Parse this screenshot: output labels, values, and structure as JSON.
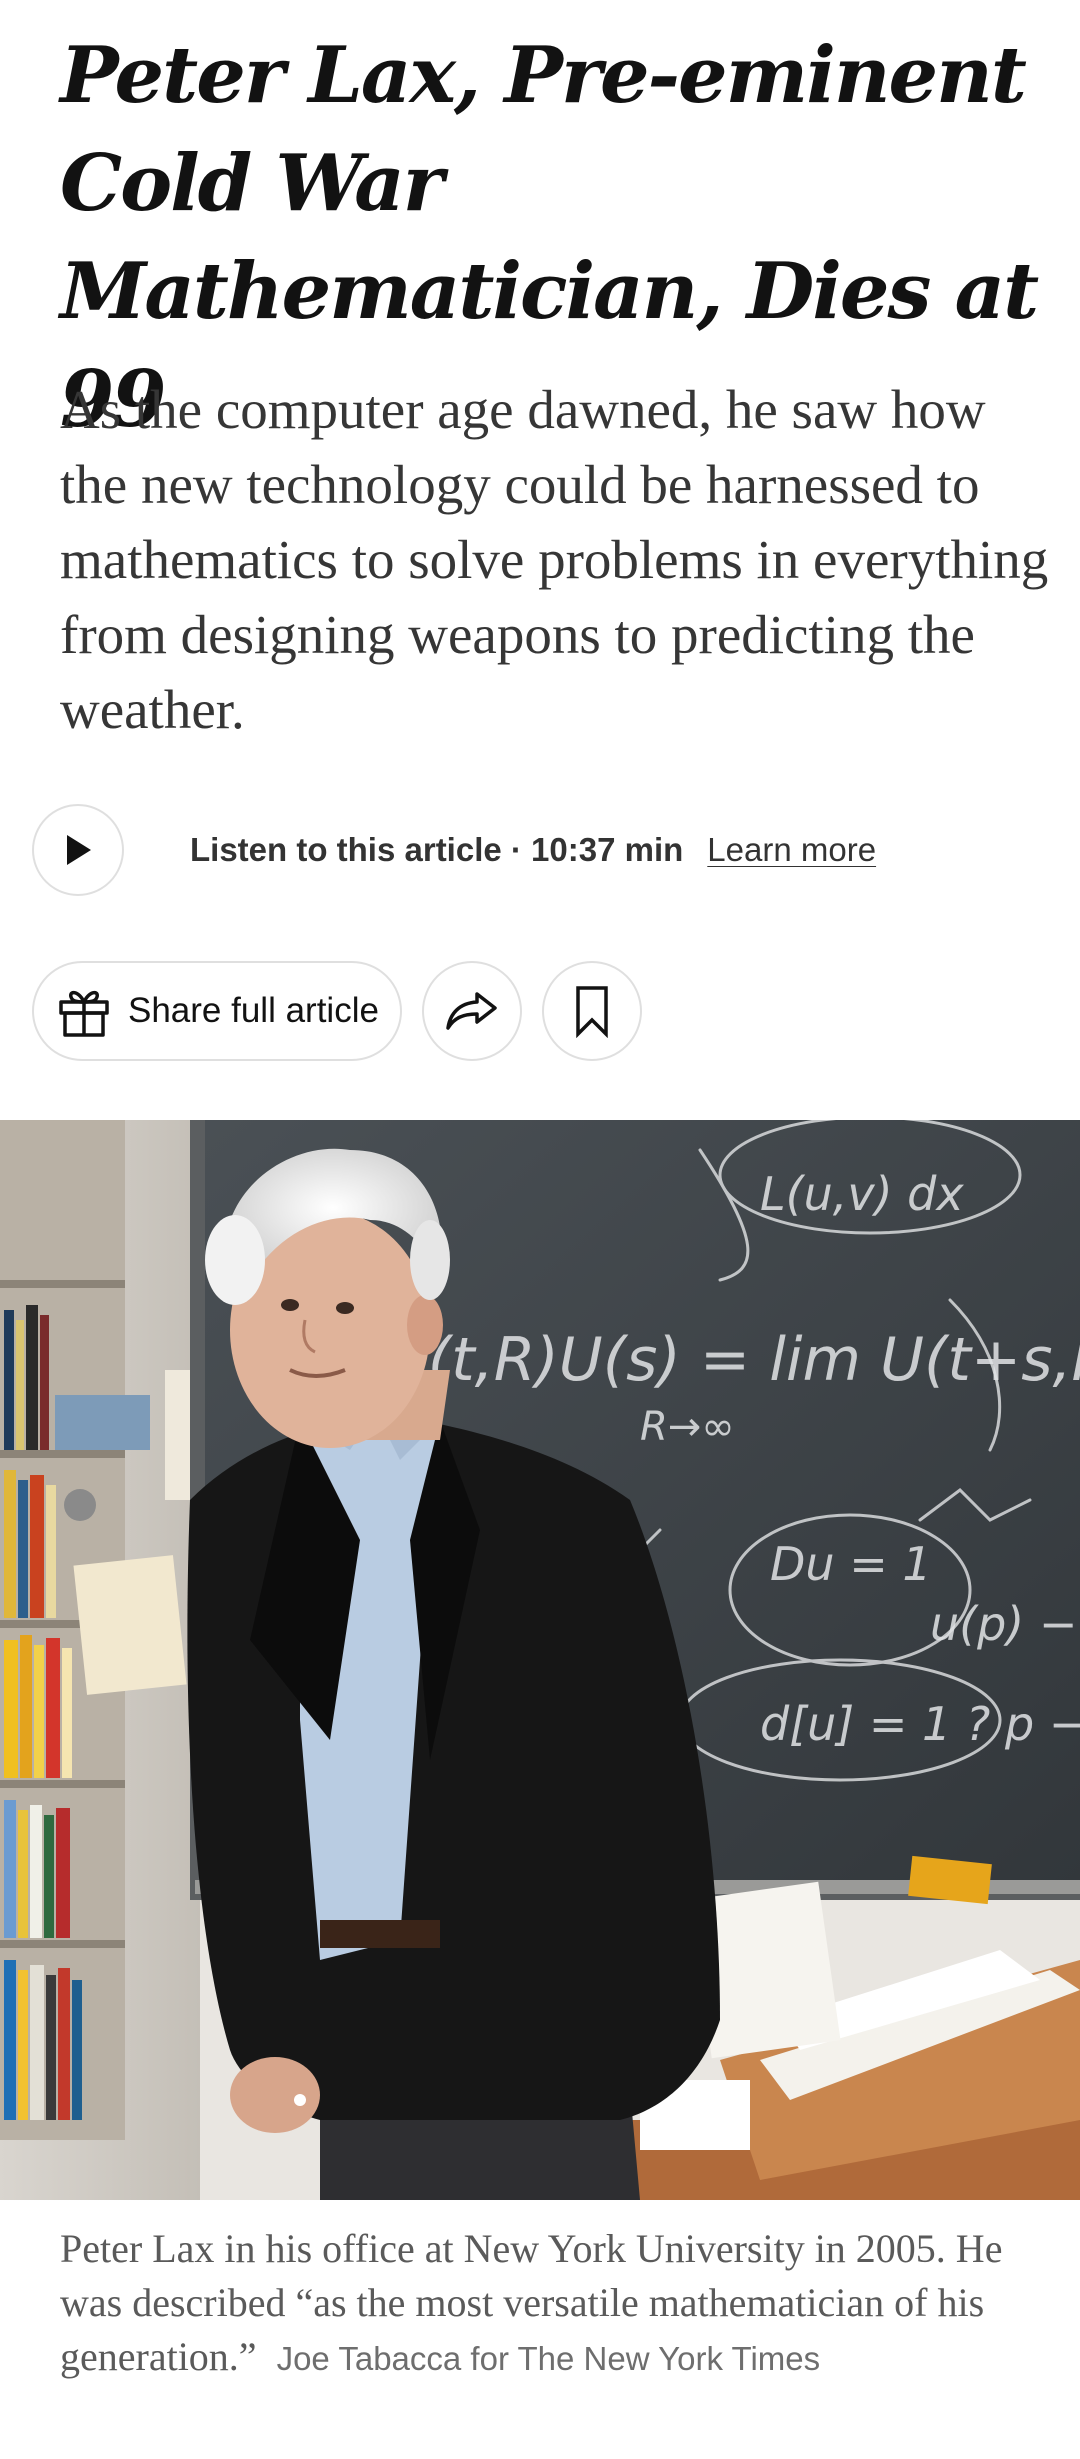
{
  "article": {
    "headline": "Peter Lax, Pre-eminent Cold War Mathematician, Dies at 99",
    "summary": "As the computer age dawned, he saw how the new technology could be harnessed to mathematics to solve problems in everything from designing weapons to predicting the weather."
  },
  "audio": {
    "play_icon": "play-icon",
    "listen_label": "Listen to this article · 10:37 min",
    "learn_more": "Learn more"
  },
  "actions": {
    "share_label": "Share full article",
    "gift_icon": "gift-icon",
    "share_icon": "share-arrow-icon",
    "bookmark_icon": "bookmark-icon"
  },
  "photo": {
    "chalk_lines": [
      "J(t,R)U(s) = lim U(t+s,R)",
      "R→∞",
      "Du = 1",
      "u(p) −",
      "d[u] = 1 ? p −",
      "L(u,v) dx"
    ],
    "caption": "Peter Lax in his office at New York University in 2005. He was described “as the most versatile mathematician of his generation.”",
    "credit": "Joe Tabacca for The New York Times"
  },
  "colors": {
    "text": "#121212",
    "summary": "#363636",
    "caption": "#5a5a5a",
    "border": "#dfdfdf",
    "chalkboard": "#3d4348"
  }
}
